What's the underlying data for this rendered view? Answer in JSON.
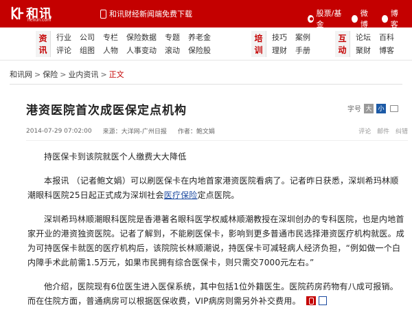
{
  "header": {
    "logo_text": "和讯",
    "logo_domain": "hexun.com",
    "promo_text": "和讯财经新闻端免费下载",
    "search_options": [
      {
        "label": "股票/基金",
        "selected": true
      },
      {
        "label": "微博",
        "selected": false
      },
      {
        "label": "博客",
        "selected": false
      }
    ]
  },
  "nav": {
    "groups": [
      {
        "head": [
          "资",
          "讯"
        ],
        "cols": [
          [
            "行业",
            "评论"
          ],
          [
            "公司",
            "组图"
          ],
          [
            "专栏",
            "人物"
          ],
          [
            "保险数据",
            "人事变动"
          ],
          [
            "专题",
            "滚动"
          ],
          [
            "养老金",
            "保险股"
          ]
        ]
      },
      {
        "head": [
          "培",
          "训"
        ],
        "cols": [
          [
            "技巧",
            "理财"
          ],
          [
            "案例",
            "手册"
          ]
        ]
      },
      {
        "head": [
          "互",
          "动"
        ],
        "cols": [
          [
            "论坛",
            "聚财"
          ],
          [
            "百科",
            "博客"
          ]
        ]
      }
    ]
  },
  "breadcrumb": {
    "items": [
      "和讯网",
      "保险",
      "业内资讯"
    ],
    "current": "正文",
    "separator": ">"
  },
  "article": {
    "title": "港资医院首次成医保定点机构",
    "font_label": "字号",
    "font_big": "大",
    "font_small": "小",
    "date": "2014-07-29 07:02:00",
    "source_label": "来源：",
    "source": "大洋网-广州日报",
    "author_label": "作者：",
    "author": "鲍文娟",
    "actions": [
      "评论",
      "邮件",
      "纠错"
    ],
    "paragraphs": [
      {
        "before": "持医保卡到该院就医个人缴费大大降低",
        "link": "",
        "after": ""
      },
      {
        "before": "本报讯 （记者鲍文娟）可以刷医保卡在内地首家港资医院看病了。记者昨日获悉，深圳希玛林顺潮眼科医院25日起正式成为深圳社会",
        "link": "医疗保险",
        "after": "定点医院。"
      },
      {
        "before": "深圳希玛林顺潮眼科医院是香港著名眼科医学权威林顺潮教授在深圳创办的专科医院，也是内地首家开业的港资独资医院。记者了解到，不能刷医保卡，影响到更多普通市民选择港资医疗机构就医。成为可持医保卡就医的医疗机构后，该院院长林顺潮说，持医保卡可减轻病人经济负担，“例如做一个白内障手术此前需1.5万元，如果市民拥有综合医保卡，则只需交7000元左右。”",
        "link": "",
        "after": ""
      },
      {
        "before": "他介绍，医院现有6位医生进入医保系统，其中包括1位外籍医生。医院药房药物有八成可报销。而在住院方面，普通病房可以根据医保收费，VIP病房则需另外补交费用。",
        "link": "",
        "after": ""
      }
    ]
  },
  "colors": {
    "brand_red": "#c40000",
    "link_blue": "#1c4aa0"
  }
}
